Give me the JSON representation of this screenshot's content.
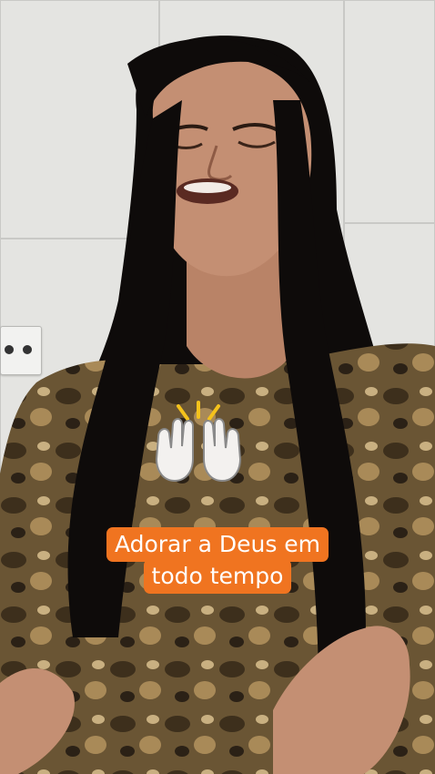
{
  "caption": {
    "line1": "Adorar a Deus em",
    "line2": "todo tempo"
  },
  "colors": {
    "caption_bg": "#f07420",
    "caption_text": "#ffffff",
    "hair": "#0e0b0a",
    "skin": "#c48f73",
    "shirt": "#6a5534",
    "wall": "#e4e4e1"
  },
  "icons": {
    "emoji": "raising-hands-icon"
  }
}
